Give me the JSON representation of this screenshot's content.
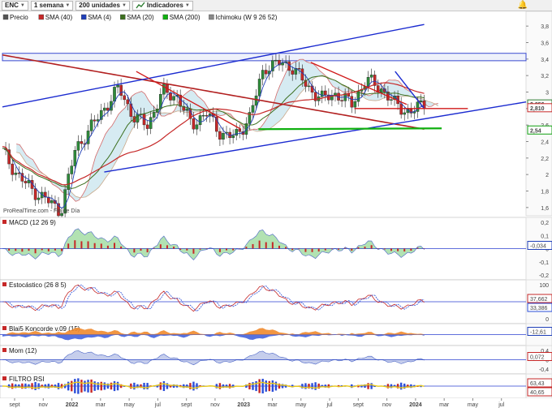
{
  "toolbar": {
    "symbol": "ENC",
    "period": "1 semana",
    "units": "200 unidades",
    "indicators": "Indicadores",
    "ind_sublabel": "ProRealTime"
  },
  "colors": {
    "up": "#2e8b3a",
    "down": "#c62828",
    "sma40": "#c62828",
    "sma4": "#1f3fb8",
    "sma20": "#3c6f1e",
    "sma200": "#10b010",
    "channel": "#1b2bd0",
    "bg": "#ffffff"
  },
  "price_panel": {
    "legend": [
      "Precio",
      "SMA (40)",
      "SMA (4)",
      "SMA (20)",
      "SMA (200)",
      "Ichimoku (W 9 26 52)"
    ],
    "watermark": "ProRealTime.com - Fin de Día",
    "y_ticks": [
      "3,8",
      "3,6",
      "3,4",
      "3,2",
      "3",
      "2,8",
      "2,6",
      "2,4",
      "2,2",
      "2",
      "1,8",
      "1,6"
    ],
    "badges": [
      {
        "text": "2,856",
        "color": "#2e7d32"
      },
      {
        "text": "2,810",
        "color": "#c62828"
      },
      {
        "text": "2,54",
        "color": "#10a010"
      }
    ]
  },
  "macd_panel": {
    "title": "MACD (12 26 9)",
    "y_ticks": [
      "0,2",
      "0,1",
      "0",
      "-0,1",
      "-0,2"
    ],
    "badges": [
      {
        "text": "-0,034",
        "color": "#1f3fb8"
      }
    ]
  },
  "stoch_panel": {
    "title": "Estocástico (26 8 5)",
    "y_ticks": [
      "100",
      "50",
      "0"
    ],
    "badges": [
      {
        "text": "37,662",
        "color": "#c62828"
      },
      {
        "text": "33,386",
        "color": "#2b4fd8"
      }
    ]
  },
  "blai5_panel": {
    "title": "Blai5 Koncorde v.09 (15)",
    "y_ticks": [],
    "badges": [
      {
        "text": "-12,61",
        "color": "#1f3fb8"
      }
    ]
  },
  "mom_panel": {
    "title": "Mom (12)",
    "y_ticks": [
      "0,4",
      "0",
      "-0,4"
    ],
    "badges": [
      {
        "text": "0,072",
        "color": "#c62828"
      }
    ]
  },
  "rsi_panel": {
    "title": "FILTRO RSI",
    "y_ticks": [],
    "badges": [
      {
        "text": "63,43",
        "color": "#c62828"
      },
      {
        "text": "40,65",
        "color": "#c62828"
      }
    ]
  },
  "x_axis": [
    "sept",
    "nov",
    "2022",
    "mar",
    "may",
    "jul",
    "sept",
    "nov",
    "2023",
    "mar",
    "may",
    "jul",
    "sept",
    "nov",
    "2024",
    "mar",
    "may",
    "jul"
  ],
  "chart_data": {
    "type": "candlestick",
    "title": "ENC",
    "period": "weekly",
    "x_range": [
      "2021-08",
      "2024-08"
    ],
    "ylim": [
      1.5,
      3.9
    ],
    "close_series": {
      "name": "Precio",
      "dates": [
        "2021-08",
        "2021-09",
        "2021-10",
        "2021-11",
        "2021-12",
        "2022-01",
        "2022-02",
        "2022-03",
        "2022-04",
        "2022-05",
        "2022-06",
        "2022-07",
        "2022-08",
        "2022-09",
        "2022-10",
        "2022-11",
        "2022-12",
        "2023-01",
        "2023-02",
        "2023-03",
        "2023-04",
        "2023-05",
        "2023-06",
        "2023-07",
        "2023-08",
        "2023-09",
        "2023-10",
        "2023-11",
        "2023-12",
        "2024-01"
      ],
      "values": [
        2.28,
        2.0,
        1.82,
        1.7,
        1.55,
        2.3,
        2.55,
        2.8,
        3.05,
        2.7,
        2.6,
        3.0,
        2.95,
        2.6,
        2.75,
        2.5,
        2.45,
        2.7,
        3.3,
        3.35,
        3.3,
        3.05,
        2.92,
        2.98,
        2.85,
        3.15,
        3.05,
        2.85,
        2.75,
        2.86
      ]
    },
    "levels": {
      "last": 2.856,
      "sma40": 2.81,
      "sma200": 2.54
    },
    "trendlines": [
      {
        "name": "channel-upper",
        "color": "blue",
        "from": [
          "2021-08",
          2.82
        ],
        "to": [
          "2024-01",
          3.82
        ]
      },
      {
        "name": "channel-lower",
        "color": "blue",
        "from": [
          "2022-03",
          2.03
        ],
        "to": [
          "2024-08",
          2.88
        ]
      },
      {
        "name": "upper-resistance",
        "color": "blue",
        "from": [
          "2023-11",
          3.25
        ],
        "to": [
          "2024-01",
          2.8
        ]
      }
    ],
    "zone": [
      3.38,
      3.47
    ]
  }
}
